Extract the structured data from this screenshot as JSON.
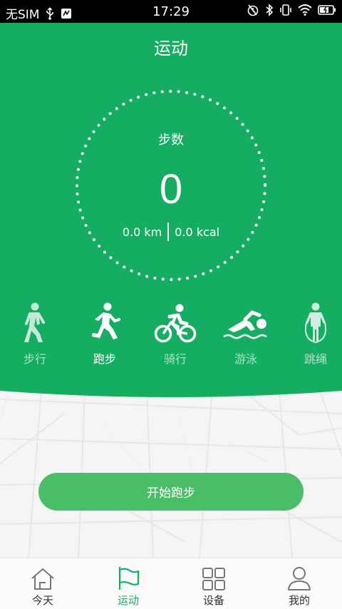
{
  "status_bar": {
    "carrier": "无SIM",
    "time": "17:29"
  },
  "header": {
    "title": "运动"
  },
  "ring": {
    "label": "步数",
    "steps": "0",
    "distance": "0.0 km",
    "calories": "0.0 kcal"
  },
  "modes": [
    {
      "label": "步行",
      "icon": "walk-icon",
      "active": false
    },
    {
      "label": "跑步",
      "icon": "run-icon",
      "active": true
    },
    {
      "label": "骑行",
      "icon": "bike-icon",
      "active": false
    },
    {
      "label": "游泳",
      "icon": "swim-icon",
      "active": false
    },
    {
      "label": "跳绳",
      "icon": "jump-rope-icon",
      "active": false
    }
  ],
  "start_button": {
    "label": "开始跑步"
  },
  "tabbar": {
    "items": [
      {
        "label": "今天",
        "icon": "home-icon",
        "active": false
      },
      {
        "label": "运动",
        "icon": "flag-icon",
        "active": true
      },
      {
        "label": "设备",
        "icon": "grid-icon",
        "active": false
      },
      {
        "label": "我的",
        "icon": "user-icon",
        "active": false
      }
    ]
  },
  "colors": {
    "primary": "#15ad62",
    "button": "#49bd68",
    "status_bar": "#000000"
  }
}
